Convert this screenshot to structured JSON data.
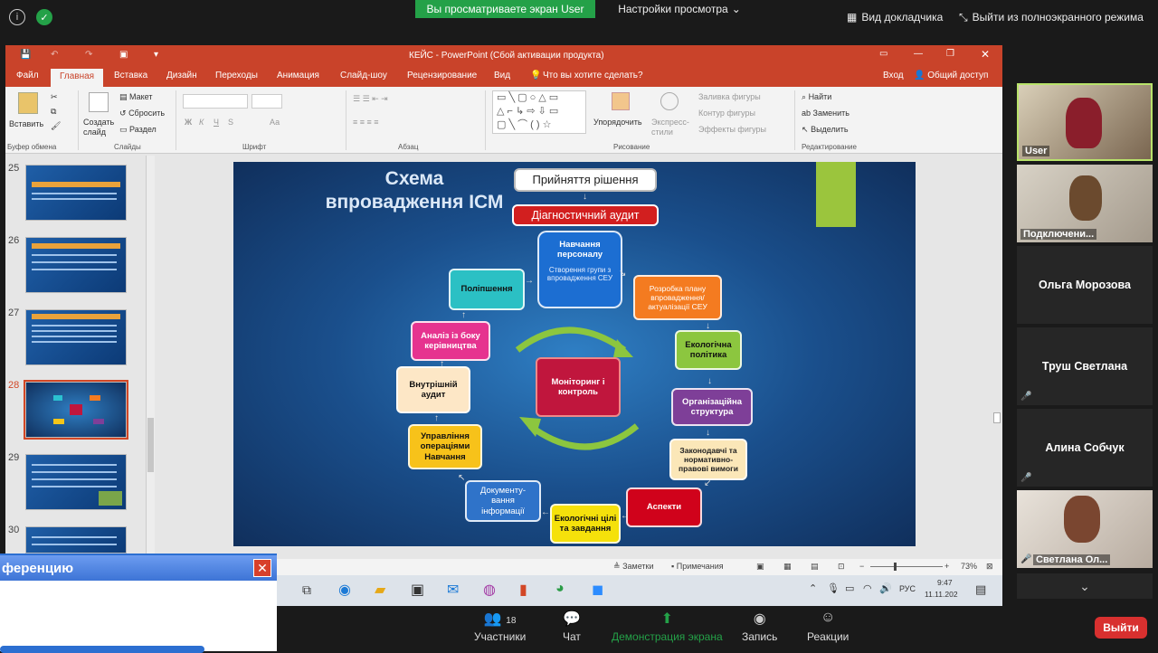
{
  "zoom_top": {
    "viewing_label": "Вы просматриваете экран User",
    "view_options_label": "Настройки просмотра",
    "speaker_view_label": "Вид докладчика",
    "exit_fullscreen_label": "Выйти из полноэкранного режима"
  },
  "ppt": {
    "title": "КЕЙС  -  PowerPoint (Сбой активации продукта)",
    "tabs": [
      "Файл",
      "Главная",
      "Вставка",
      "Дизайн",
      "Переходы",
      "Анимация",
      "Слайд-шоу",
      "Рецензирование",
      "Вид"
    ],
    "tell_me": "Что вы хотите сделать?",
    "signin": "Вход",
    "share": "Общий доступ",
    "ribbon": {
      "paste": "Вставить",
      "create_slide": "Создать слайд",
      "layout": "Макет",
      "reset": "Сбросить",
      "section": "Раздел",
      "arrange": "Упорядочить",
      "express_styles": "Экспресс-стили",
      "shape_fill": "Заливка фигуры",
      "shape_outline": "Контур фигуры",
      "shape_effects": "Эффекты фигуры",
      "find": "Найти",
      "replace": "Заменить",
      "select": "Выделить",
      "groups": {
        "clipboard": "Буфер обмена",
        "slides": "Слайды",
        "font": "Шрифт",
        "paragraph": "Абзац",
        "drawing": "Рисование",
        "editing": "Редактирование"
      }
    },
    "thumbnails": [
      "25",
      "26",
      "27",
      "28",
      "29",
      "30"
    ],
    "status": {
      "notes": "Заметки",
      "comments": "Примечания",
      "zoom": "73%"
    },
    "taskbar": {
      "lang": "РУС",
      "time": "9:47",
      "date": "11.11.202"
    }
  },
  "slide": {
    "title": "Схема впровадження ІСМ",
    "top_box": "Прийняття рішення",
    "diag_box": "Діагностичний аудит",
    "training": "Навчання персоналу",
    "group": "Створення групи з впровадження СЕУ",
    "plan": "Розробка плану впровадження/ актуалізації СЕУ",
    "policy": "Екологічна політика",
    "org": "Організаційна структура",
    "legal": "Законодавчі та нормативно-правові вимоги",
    "aspects": "Аспекти",
    "goals": "Екологічні цілі та завдання",
    "docs": "Документу-вання інформації",
    "ops": "Управління операціями Навчання",
    "audit": "Внутрішній аудит",
    "analysis": "Аналіз із боку керівництва",
    "improve": "Поліпшення",
    "monitor": "Моніторинг і контроль"
  },
  "participants": [
    {
      "name": "User",
      "video": true
    },
    {
      "name": "Подключени...",
      "video": true
    },
    {
      "name": "Ольга Морозова",
      "video": false
    },
    {
      "name": "Труш Светлана",
      "video": false,
      "muted": true
    },
    {
      "name": "Алина Собчук",
      "video": false,
      "muted": true
    },
    {
      "name": "Светлана Ол...",
      "video": true,
      "muted": true
    }
  ],
  "zoom_bottom": {
    "participants_label": "Участники",
    "participants_count": "18",
    "chat_label": "Чат",
    "share_label": "Демонстрация экрана",
    "record_label": "Запись",
    "reactions_label": "Реакции",
    "leave_label": "Выйти"
  },
  "popup": {
    "title": "ференцию"
  }
}
